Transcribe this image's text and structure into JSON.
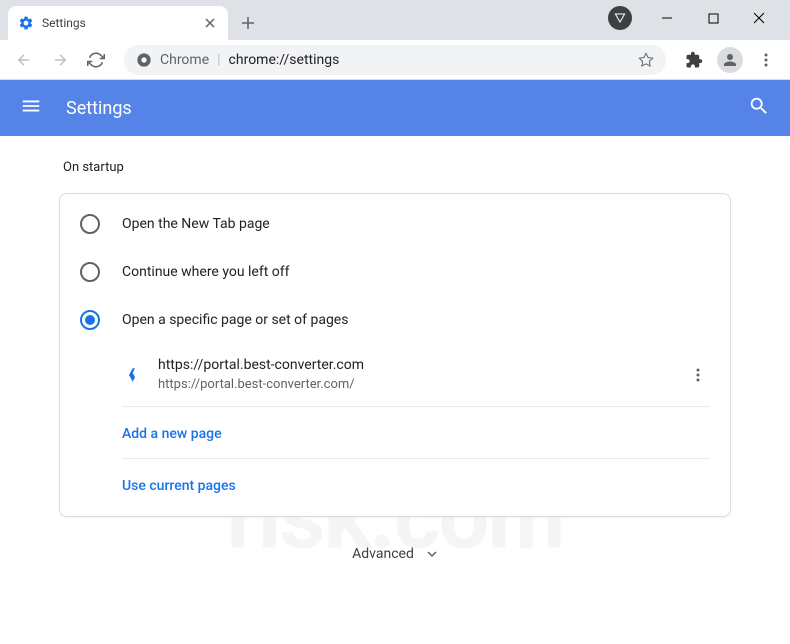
{
  "tab": {
    "title": "Settings"
  },
  "omnibox": {
    "prefix": "Chrome",
    "url": "chrome://settings"
  },
  "header": {
    "title": "Settings"
  },
  "section": {
    "title": "On startup"
  },
  "radios": [
    {
      "label": "Open the New Tab page",
      "checked": false
    },
    {
      "label": "Continue where you left off",
      "checked": false
    },
    {
      "label": "Open a specific page or set of pages",
      "checked": true
    }
  ],
  "startup_page": {
    "title": "https://portal.best-converter.com",
    "url": "https://portal.best-converter.com/"
  },
  "actions": {
    "add_page": "Add a new page",
    "use_current": "Use current pages"
  },
  "advanced_label": "Advanced",
  "colors": {
    "header_bg": "#5583e7",
    "link": "#1a73e8"
  }
}
